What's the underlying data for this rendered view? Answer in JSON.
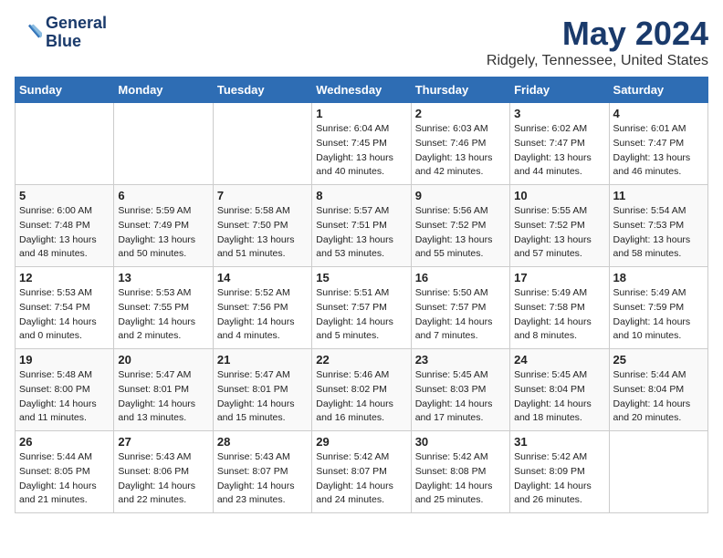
{
  "header": {
    "logo_line1": "General",
    "logo_line2": "Blue",
    "title": "May 2024",
    "subtitle": "Ridgely, Tennessee, United States"
  },
  "days_of_week": [
    "Sunday",
    "Monday",
    "Tuesday",
    "Wednesday",
    "Thursday",
    "Friday",
    "Saturday"
  ],
  "weeks": [
    [
      {
        "day": "",
        "sunrise": "",
        "sunset": "",
        "daylight": ""
      },
      {
        "day": "",
        "sunrise": "",
        "sunset": "",
        "daylight": ""
      },
      {
        "day": "",
        "sunrise": "",
        "sunset": "",
        "daylight": ""
      },
      {
        "day": "1",
        "sunrise": "Sunrise: 6:04 AM",
        "sunset": "Sunset: 7:45 PM",
        "daylight": "Daylight: 13 hours and 40 minutes."
      },
      {
        "day": "2",
        "sunrise": "Sunrise: 6:03 AM",
        "sunset": "Sunset: 7:46 PM",
        "daylight": "Daylight: 13 hours and 42 minutes."
      },
      {
        "day": "3",
        "sunrise": "Sunrise: 6:02 AM",
        "sunset": "Sunset: 7:47 PM",
        "daylight": "Daylight: 13 hours and 44 minutes."
      },
      {
        "day": "4",
        "sunrise": "Sunrise: 6:01 AM",
        "sunset": "Sunset: 7:47 PM",
        "daylight": "Daylight: 13 hours and 46 minutes."
      }
    ],
    [
      {
        "day": "5",
        "sunrise": "Sunrise: 6:00 AM",
        "sunset": "Sunset: 7:48 PM",
        "daylight": "Daylight: 13 hours and 48 minutes."
      },
      {
        "day": "6",
        "sunrise": "Sunrise: 5:59 AM",
        "sunset": "Sunset: 7:49 PM",
        "daylight": "Daylight: 13 hours and 50 minutes."
      },
      {
        "day": "7",
        "sunrise": "Sunrise: 5:58 AM",
        "sunset": "Sunset: 7:50 PM",
        "daylight": "Daylight: 13 hours and 51 minutes."
      },
      {
        "day": "8",
        "sunrise": "Sunrise: 5:57 AM",
        "sunset": "Sunset: 7:51 PM",
        "daylight": "Daylight: 13 hours and 53 minutes."
      },
      {
        "day": "9",
        "sunrise": "Sunrise: 5:56 AM",
        "sunset": "Sunset: 7:52 PM",
        "daylight": "Daylight: 13 hours and 55 minutes."
      },
      {
        "day": "10",
        "sunrise": "Sunrise: 5:55 AM",
        "sunset": "Sunset: 7:52 PM",
        "daylight": "Daylight: 13 hours and 57 minutes."
      },
      {
        "day": "11",
        "sunrise": "Sunrise: 5:54 AM",
        "sunset": "Sunset: 7:53 PM",
        "daylight": "Daylight: 13 hours and 58 minutes."
      }
    ],
    [
      {
        "day": "12",
        "sunrise": "Sunrise: 5:53 AM",
        "sunset": "Sunset: 7:54 PM",
        "daylight": "Daylight: 14 hours and 0 minutes."
      },
      {
        "day": "13",
        "sunrise": "Sunrise: 5:53 AM",
        "sunset": "Sunset: 7:55 PM",
        "daylight": "Daylight: 14 hours and 2 minutes."
      },
      {
        "day": "14",
        "sunrise": "Sunrise: 5:52 AM",
        "sunset": "Sunset: 7:56 PM",
        "daylight": "Daylight: 14 hours and 4 minutes."
      },
      {
        "day": "15",
        "sunrise": "Sunrise: 5:51 AM",
        "sunset": "Sunset: 7:57 PM",
        "daylight": "Daylight: 14 hours and 5 minutes."
      },
      {
        "day": "16",
        "sunrise": "Sunrise: 5:50 AM",
        "sunset": "Sunset: 7:57 PM",
        "daylight": "Daylight: 14 hours and 7 minutes."
      },
      {
        "day": "17",
        "sunrise": "Sunrise: 5:49 AM",
        "sunset": "Sunset: 7:58 PM",
        "daylight": "Daylight: 14 hours and 8 minutes."
      },
      {
        "day": "18",
        "sunrise": "Sunrise: 5:49 AM",
        "sunset": "Sunset: 7:59 PM",
        "daylight": "Daylight: 14 hours and 10 minutes."
      }
    ],
    [
      {
        "day": "19",
        "sunrise": "Sunrise: 5:48 AM",
        "sunset": "Sunset: 8:00 PM",
        "daylight": "Daylight: 14 hours and 11 minutes."
      },
      {
        "day": "20",
        "sunrise": "Sunrise: 5:47 AM",
        "sunset": "Sunset: 8:01 PM",
        "daylight": "Daylight: 14 hours and 13 minutes."
      },
      {
        "day": "21",
        "sunrise": "Sunrise: 5:47 AM",
        "sunset": "Sunset: 8:01 PM",
        "daylight": "Daylight: 14 hours and 15 minutes."
      },
      {
        "day": "22",
        "sunrise": "Sunrise: 5:46 AM",
        "sunset": "Sunset: 8:02 PM",
        "daylight": "Daylight: 14 hours and 16 minutes."
      },
      {
        "day": "23",
        "sunrise": "Sunrise: 5:45 AM",
        "sunset": "Sunset: 8:03 PM",
        "daylight": "Daylight: 14 hours and 17 minutes."
      },
      {
        "day": "24",
        "sunrise": "Sunrise: 5:45 AM",
        "sunset": "Sunset: 8:04 PM",
        "daylight": "Daylight: 14 hours and 18 minutes."
      },
      {
        "day": "25",
        "sunrise": "Sunrise: 5:44 AM",
        "sunset": "Sunset: 8:04 PM",
        "daylight": "Daylight: 14 hours and 20 minutes."
      }
    ],
    [
      {
        "day": "26",
        "sunrise": "Sunrise: 5:44 AM",
        "sunset": "Sunset: 8:05 PM",
        "daylight": "Daylight: 14 hours and 21 minutes."
      },
      {
        "day": "27",
        "sunrise": "Sunrise: 5:43 AM",
        "sunset": "Sunset: 8:06 PM",
        "daylight": "Daylight: 14 hours and 22 minutes."
      },
      {
        "day": "28",
        "sunrise": "Sunrise: 5:43 AM",
        "sunset": "Sunset: 8:07 PM",
        "daylight": "Daylight: 14 hours and 23 minutes."
      },
      {
        "day": "29",
        "sunrise": "Sunrise: 5:42 AM",
        "sunset": "Sunset: 8:07 PM",
        "daylight": "Daylight: 14 hours and 24 minutes."
      },
      {
        "day": "30",
        "sunrise": "Sunrise: 5:42 AM",
        "sunset": "Sunset: 8:08 PM",
        "daylight": "Daylight: 14 hours and 25 minutes."
      },
      {
        "day": "31",
        "sunrise": "Sunrise: 5:42 AM",
        "sunset": "Sunset: 8:09 PM",
        "daylight": "Daylight: 14 hours and 26 minutes."
      },
      {
        "day": "",
        "sunrise": "",
        "sunset": "",
        "daylight": ""
      }
    ]
  ]
}
